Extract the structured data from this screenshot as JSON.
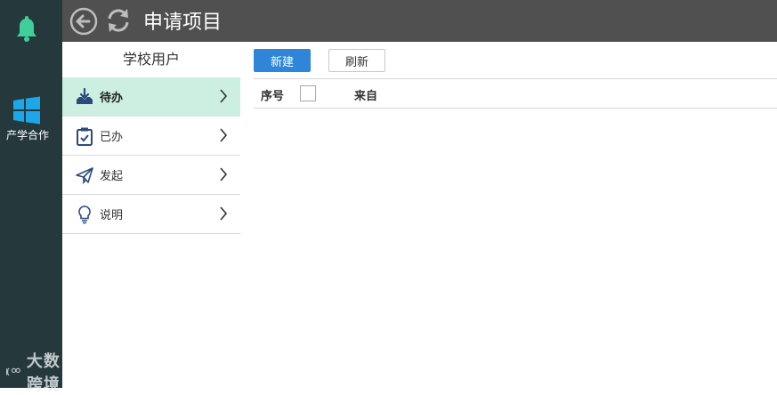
{
  "header": {
    "title": "申请项目"
  },
  "rail": {
    "item_label": "产学合作",
    "watermark": "大数跨境"
  },
  "sidebar": {
    "title": "学校用户",
    "items": [
      {
        "label": "待办",
        "icon": "inbox-download-icon",
        "active": true
      },
      {
        "label": "已办",
        "icon": "clipboard-check-icon",
        "active": false
      },
      {
        "label": "发起",
        "icon": "paper-plane-icon",
        "active": false
      },
      {
        "label": "说明",
        "icon": "lightbulb-icon",
        "active": false
      }
    ]
  },
  "toolbar": {
    "new_label": "新建",
    "refresh_label": "刷新"
  },
  "table": {
    "columns": [
      "序号",
      "来自"
    ]
  },
  "colors": {
    "rail_bg": "#25393d",
    "header_bg": "#505050",
    "accent": "#2f86d8",
    "active_bg": "#ccefe2",
    "bell": "#3ecf9a"
  }
}
